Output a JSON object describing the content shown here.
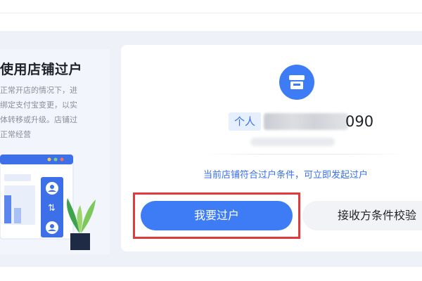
{
  "intro": {
    "title": "使用店铺过户",
    "description": "正常开店的情况下，进\n绑定支付宝变更，以实\n体转移或升级。店铺过\n正常经营"
  },
  "shop": {
    "type_badge": "个人",
    "name_suffix": "090"
  },
  "status": {
    "hint": "当前店铺符合过户条件，可立即发起过户"
  },
  "actions": {
    "primary_label": "我要过户",
    "secondary_label": "接收方条件校验"
  },
  "colors": {
    "accent": "#3d7cf5",
    "highlight": "#e23a3a",
    "background": "#eef1f8"
  },
  "icons": {
    "shop_avatar": "store-icon"
  }
}
